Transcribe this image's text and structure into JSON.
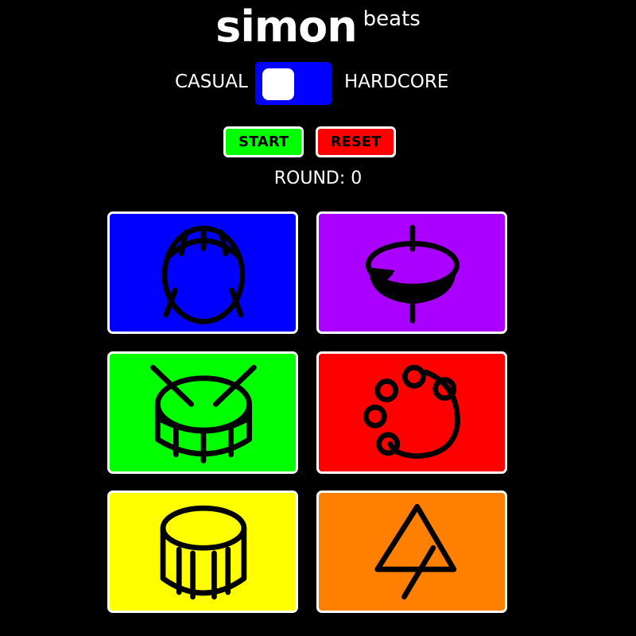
{
  "header": {
    "title_main": "simon",
    "title_sub": "beats"
  },
  "mode": {
    "left_label": "CASUAL",
    "right_label": "HARDCORE",
    "toggle_color": "#0000ff",
    "selected": "CASUAL"
  },
  "controls": {
    "start_label": "START",
    "reset_label": "RESET",
    "start_color": "#00ff00",
    "reset_color": "#ff0000"
  },
  "status": {
    "round_text": "ROUND: 0"
  },
  "pads": [
    {
      "name": "bass-drum",
      "color": "#0000ff",
      "icon": "bass-drum-icon"
    },
    {
      "name": "cymbal",
      "color": "#aa00ff",
      "icon": "cymbal-icon"
    },
    {
      "name": "snare-drum",
      "color": "#00ff00",
      "icon": "snare-drum-icon"
    },
    {
      "name": "tambourine",
      "color": "#ff0000",
      "icon": "tambourine-icon"
    },
    {
      "name": "tom-drum",
      "color": "#ffff00",
      "icon": "tom-drum-icon"
    },
    {
      "name": "triangle",
      "color": "#ff8000",
      "icon": "triangle-icon"
    }
  ]
}
